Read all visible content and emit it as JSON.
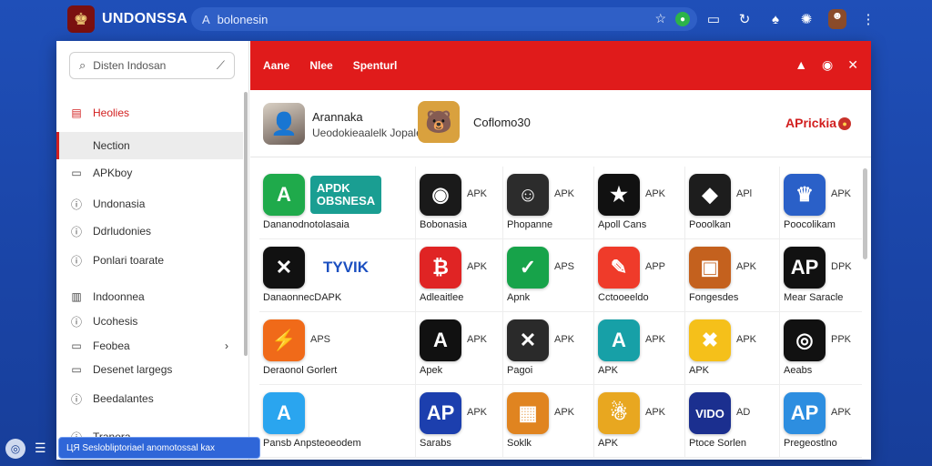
{
  "browser": {
    "brand": "UNDONSSA",
    "url": "bolonesin",
    "colors": {
      "bg": "#1f4fb8",
      "accent": "#e01b1b"
    }
  },
  "sidebar": {
    "search_placeholder": "Disten Indosan",
    "items": [
      {
        "label": "Heolies",
        "icon": "calendar-icon"
      },
      {
        "label": "Nection",
        "icon": ""
      },
      {
        "label": "APKboy",
        "icon": "window-icon"
      },
      {
        "label": "Undonasia",
        "icon": "info-icon"
      },
      {
        "label": "Ddrludonies",
        "icon": "info-icon"
      },
      {
        "label": "Ponlari toarate",
        "icon": "info-icon"
      },
      {
        "label": "Indoonnea",
        "icon": "grid-icon"
      },
      {
        "label": "Ucohesis",
        "icon": "info-icon"
      },
      {
        "label": "Feobea",
        "icon": "window-icon"
      },
      {
        "label": "Desenet largegs",
        "icon": "window-icon"
      },
      {
        "label": "Beedalantes",
        "icon": "info-icon"
      },
      {
        "label": "Tranera",
        "icon": "info-icon"
      }
    ]
  },
  "tabs": [
    "Aane",
    "Nlee",
    "Spenturl"
  ],
  "featured": {
    "item1_title": "Arannaka",
    "item1_sub": "Ueodokieaalelk Jopalek",
    "item2_title": "Coflomo30",
    "logo_text": "APrickia"
  },
  "apps": [
    {
      "label": "Dananodnotolasaia",
      "tag": "",
      "logo": "APDK\nOBSNESA",
      "color": "#1faa4b",
      "glyph": "A"
    },
    {
      "label": "Bobonasia",
      "tag": "APK",
      "color": "#1a1a1a",
      "glyph": "◉"
    },
    {
      "label": "Phopanne",
      "tag": "APK",
      "color": "#2c2c2c",
      "glyph": "☺"
    },
    {
      "label": "Apoll Cans",
      "tag": "APK",
      "color": "#111111",
      "glyph": "★"
    },
    {
      "label": "Pooolkan",
      "tag": "APl",
      "color": "#1d1d1d",
      "glyph": "◆"
    },
    {
      "label": "Poocolikam",
      "tag": "APK",
      "color": "#2a60c8",
      "glyph": "♛"
    },
    {
      "label": "DanaonnecDAPK",
      "tag": "",
      "logo": "TYVIK",
      "color": "#111111",
      "glyph": "✕"
    },
    {
      "label": "Adleaitlee",
      "tag": "APK",
      "color": "#e02424",
      "glyph": "₿"
    },
    {
      "label": "Apnk",
      "tag": "APS",
      "color": "#17a34a",
      "glyph": "✓"
    },
    {
      "label": "Cctooeeldo",
      "tag": "APP",
      "color": "#ef3b2a",
      "glyph": "✎"
    },
    {
      "label": "Fongesdes",
      "tag": "APK",
      "color": "#c4611e",
      "glyph": "▣"
    },
    {
      "label": "Mear Saracle",
      "tag": "DPK",
      "color": "#111111",
      "glyph": "AP"
    },
    {
      "label": "Deraonol Gorlert",
      "tag": "APS",
      "color": "#f06a19",
      "glyph": "⚡"
    },
    {
      "label": "Apek",
      "tag": "APK",
      "color": "#111111",
      "glyph": "A"
    },
    {
      "label": "Pagoi",
      "tag": "APK",
      "color": "#2a2a2a",
      "glyph": "✕"
    },
    {
      "label": "APK",
      "tag": "APK",
      "color": "#17a0a7",
      "glyph": "A"
    },
    {
      "label": "APK",
      "tag": "APK",
      "color": "#f5c01a",
      "glyph": "✖"
    },
    {
      "label": "Aeabs",
      "tag": "PPK",
      "color": "#111111",
      "glyph": "◎"
    },
    {
      "label": "Pansb Anpsteoeodem",
      "tag": "",
      "color": "#2aa5ef",
      "glyph": "A"
    },
    {
      "label": "Sarabs",
      "tag": "APK",
      "color": "#1c3fae",
      "glyph": "AP"
    },
    {
      "label": "Soklk",
      "tag": "APK",
      "color": "#e08420",
      "glyph": "▦"
    },
    {
      "label": "APK",
      "tag": "APK",
      "color": "#e8a720",
      "glyph": "☃"
    },
    {
      "label": "Ptoce Sorlen",
      "tag": "AD",
      "color": "#1b2f8f",
      "glyph": "VIDO"
    },
    {
      "label": "Pregeostlno",
      "tag": "APK",
      "color": "#2d8ee0",
      "glyph": "AP"
    }
  ],
  "toast": "ЦЯ Seslobliptoriael anomotossal kax",
  "icons": {
    "url_lock": "search-icon",
    "url_star": "star-icon",
    "tab_icons": [
      "alert-icon",
      "help-icon",
      "close-icon"
    ]
  }
}
